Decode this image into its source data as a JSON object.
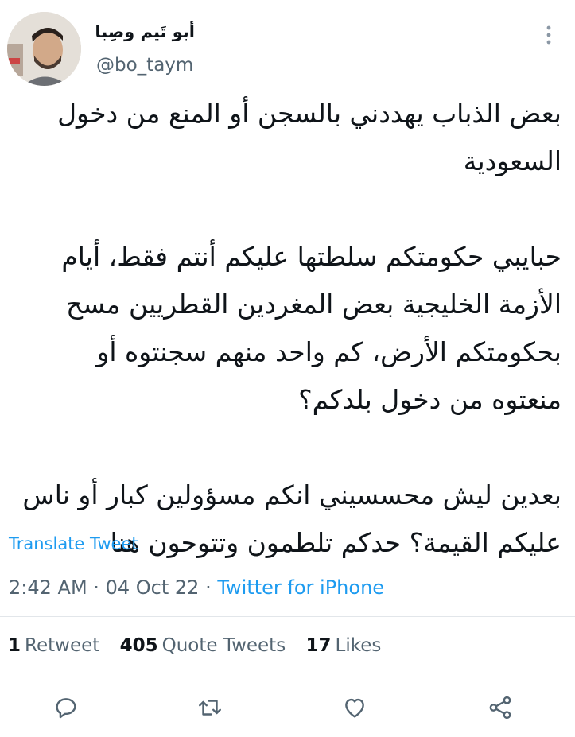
{
  "tweet": {
    "author_name": "أبو تَيم وصِبا",
    "handle": "@bo_taym",
    "paragraphs": [
      [
        "بعض الذباب يهددني بالسجن أو المنع من دخول",
        "السعودية"
      ],
      [
        "حبايبي حكومتكم سلطتها عليكم أنتم فقط، أيام",
        "الأزمة الخليجية بعض المغردين القطريين مسح",
        "بحكومتكم الأرض، كم واحد منهم سجنتوه أو",
        "منعتوه من دخول بلدكم؟"
      ],
      [
        "بعدين ليش محسسيني انكم مسؤولين كبار أو ناس",
        "عليكم القيمة؟ حدكم تلطمون وتتوحون هنا"
      ]
    ],
    "translate_label": "Translate Tweet",
    "time": "2:42 AM",
    "date": "04 Oct 22",
    "separator": "·",
    "source": "Twitter for iPhone"
  },
  "stats": {
    "retweets_count": "1",
    "retweets_label": "Retweet",
    "quotes_count": "405",
    "quotes_label": "Quote Tweets",
    "likes_count": "17",
    "likes_label": "Likes"
  },
  "icons": {
    "more": "more-vertical-icon",
    "reply": "reply-icon",
    "retweet": "retweet-icon",
    "like": "heart-icon",
    "share": "share-icon"
  },
  "colors": {
    "link": "#1d9bf0",
    "secondary_text": "#536471",
    "primary_text": "#0f1419"
  }
}
